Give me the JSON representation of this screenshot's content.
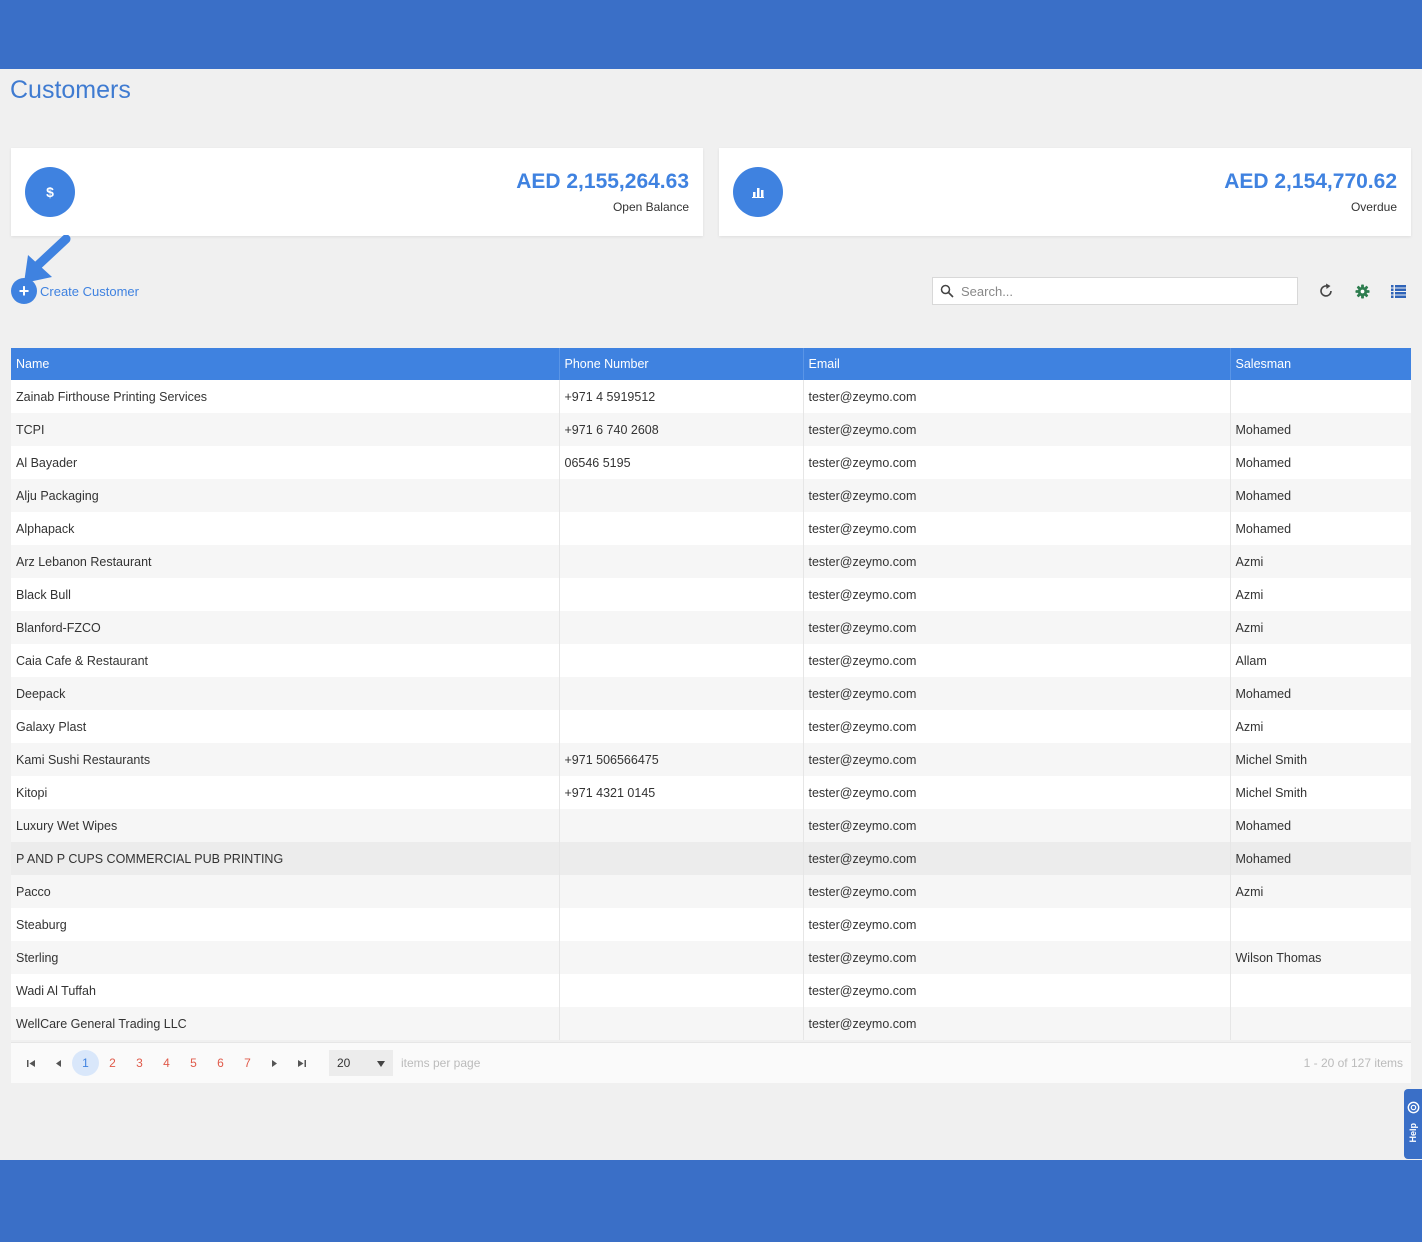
{
  "page": {
    "title": "Customers"
  },
  "summary": [
    {
      "icon": "dollar-icon",
      "glyph": "$",
      "amount": "AED 2,155,264.63",
      "caption": "Open Balance"
    },
    {
      "icon": "bar-chart-icon",
      "amount": "AED 2,154,770.62",
      "caption": "Overdue"
    }
  ],
  "toolbar": {
    "create_label": "Create Customer",
    "search_placeholder": "Search...",
    "icons": [
      "refresh-icon",
      "gear-icon",
      "list-icon"
    ]
  },
  "colors": {
    "primary": "#3f82e0",
    "bar": "#3a6fc7",
    "page_link": "#e05a4a"
  },
  "table": {
    "columns": [
      "Name",
      "Phone Number",
      "Email",
      "Salesman"
    ],
    "rows": [
      [
        "Zainab Firthouse Printing Services",
        "+971 4 5919512",
        "tester@zeymo.com",
        ""
      ],
      [
        "TCPI",
        "+971 6 740 2608",
        "tester@zeymo.com",
        "Mohamed"
      ],
      [
        "Al Bayader",
        "06546 5195",
        "tester@zeymo.com",
        "Mohamed"
      ],
      [
        "Alju Packaging",
        "",
        "tester@zeymo.com",
        "Mohamed"
      ],
      [
        "Alphapack",
        "",
        "tester@zeymo.com",
        "Mohamed"
      ],
      [
        "Arz Lebanon Restaurant",
        "",
        "tester@zeymo.com",
        "Azmi"
      ],
      [
        "Black Bull",
        "",
        "tester@zeymo.com",
        "Azmi"
      ],
      [
        "Blanford-FZCO",
        "",
        "tester@zeymo.com",
        "Azmi"
      ],
      [
        "Caia Cafe & Restaurant",
        "",
        "tester@zeymo.com",
        "Allam"
      ],
      [
        "Deepack",
        "",
        "tester@zeymo.com",
        "Mohamed"
      ],
      [
        "Galaxy Plast",
        "",
        "tester@zeymo.com",
        "Azmi"
      ],
      [
        "Kami Sushi Restaurants",
        "+971 506566475",
        "tester@zeymo.com",
        "Michel Smith"
      ],
      [
        "Kitopi",
        "+971 4321 0145",
        "tester@zeymo.com",
        "Michel Smith"
      ],
      [
        "Luxury Wet Wipes",
        "",
        "tester@zeymo.com",
        "Mohamed"
      ],
      [
        "P AND P CUPS COMMERCIAL PUB PRINTING",
        "",
        "tester@zeymo.com",
        "Mohamed"
      ],
      [
        "Pacco",
        "",
        "tester@zeymo.com",
        "Azmi"
      ],
      [
        "Steaburg",
        "",
        "tester@zeymo.com",
        ""
      ],
      [
        "Sterling",
        "",
        "tester@zeymo.com",
        "Wilson Thomas"
      ],
      [
        "Wadi Al Tuffah",
        "",
        "tester@zeymo.com",
        ""
      ],
      [
        "WellCare General Trading LLC",
        "",
        "tester@zeymo.com",
        ""
      ]
    ],
    "hover_row": 14
  },
  "pager": {
    "pages": [
      "1",
      "2",
      "3",
      "4",
      "5",
      "6",
      "7"
    ],
    "current": "1",
    "per_page": "20",
    "per_page_label": "items per page",
    "info": "1 - 20 of 127 items"
  },
  "help": {
    "label": "Help"
  }
}
